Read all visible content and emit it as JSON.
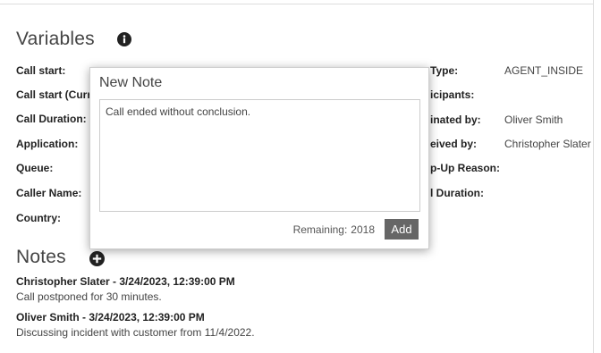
{
  "variables": {
    "title": "Variables",
    "left": [
      {
        "label": "Call start:",
        "value": ""
      },
      {
        "label": "Call start (Curr",
        "value": ""
      },
      {
        "label": "Call Duration:",
        "value": ""
      },
      {
        "label": "Application:",
        "value": ""
      },
      {
        "label": "Queue:",
        "value": ""
      },
      {
        "label": "Caller Name:",
        "value": ""
      },
      {
        "label": "Country:",
        "value": ""
      }
    ],
    "right": [
      {
        "label": "Type:",
        "value": "AGENT_INSIDE"
      },
      {
        "label": "icipants:",
        "value": ""
      },
      {
        "label": "inated by:",
        "value": "Oliver Smith"
      },
      {
        "label": "eived by:",
        "value": "Christopher Slater"
      },
      {
        "label": "p-Up Reason:",
        "value": ""
      },
      {
        "label": "l Duration:",
        "value": ""
      }
    ]
  },
  "notes": {
    "title": "Notes",
    "items": [
      {
        "header": "Christopher Slater - 3/24/2023, 12:39:00 PM",
        "text": "Call postponed for 30 minutes."
      },
      {
        "header": "Oliver Smith - 3/24/2023, 12:39:00 PM",
        "text": "Discussing incident with customer from 11/4/2022."
      }
    ]
  },
  "new_note": {
    "title": "New Note",
    "text": "Call ended without conclusion.",
    "remaining_label": "Remaining:",
    "remaining_value": "2018",
    "add_label": "Add"
  },
  "icons": {
    "variables_info": "info-icon",
    "notes_add": "plus-circle-icon"
  }
}
